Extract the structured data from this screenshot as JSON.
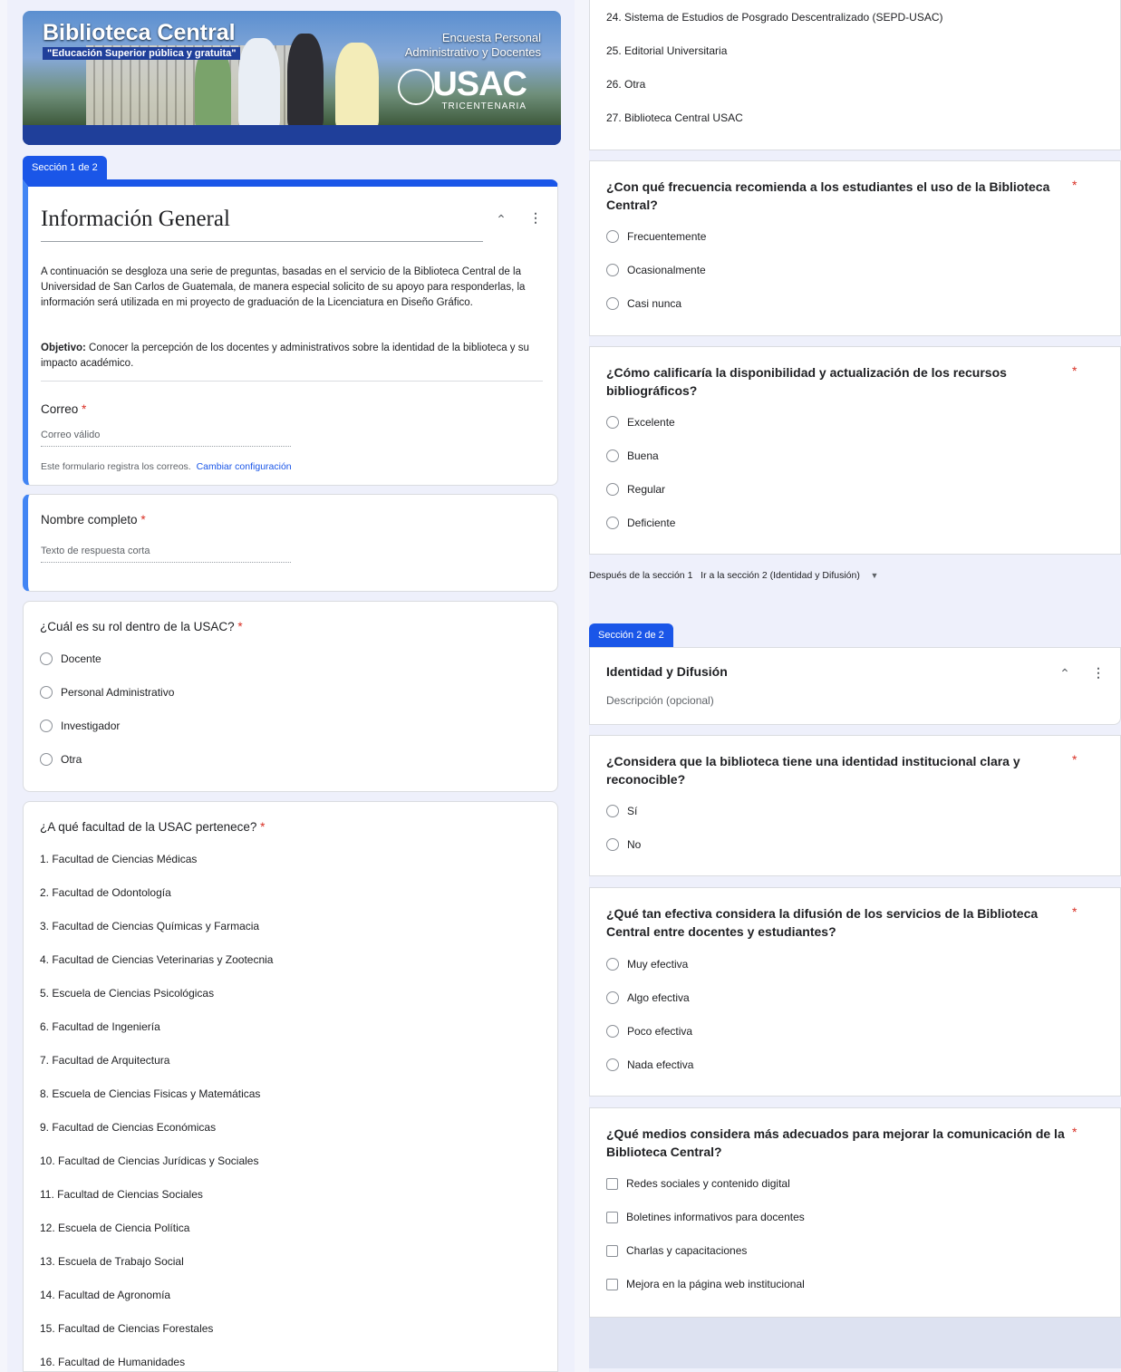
{
  "banner": {
    "title": "Biblioteca Central",
    "tagline": "\"Educación Superior pública y gratuita\"",
    "survey_line1": "Encuesta Personal",
    "survey_line2": "Administrativo y Docentes",
    "logo": "USAC",
    "logo_sub": "TRICENTENARIA"
  },
  "section1": {
    "tab": "Sección 1 de 2",
    "title": "Información General",
    "description": "A continuación se desgloza una serie de preguntas, basadas en el servicio de la Biblioteca Central de la Universidad de San Carlos de Guatemala, de manera especial solicito de su apoyo para responderlas, la información será utilizada en mi proyecto de graduación de la Licenciatura en Diseño Gráfico.",
    "objective_label": "Objetivo:",
    "objective_text": " Conocer la percepción de los docentes y administrativos sobre la identidad de la biblioteca y su impacto académico.",
    "email_label": "Correo",
    "email_placeholder": "Correo válido",
    "email_note": "Este formulario registra los correos.",
    "email_link": "Cambiar configuración"
  },
  "q_name": {
    "title": "Nombre completo",
    "placeholder": "Texto de respuesta corta"
  },
  "q_role": {
    "title": "¿Cuál es su rol dentro de la USAC?",
    "options": [
      "Docente",
      "Personal Administrativo",
      "Investigador",
      "Otra"
    ]
  },
  "q_faculty": {
    "title": "¿A qué facultad de la USAC pertenece?",
    "items": [
      "1.  Facultad de Ciencias Médicas",
      "2.  Facultad de Odontología",
      "3.  Facultad de Ciencias Químicas y Farmacia",
      "4.  Facultad de Ciencias Veterinarias y Zootecnia",
      "5.  Escuela de Ciencias Psicológicas",
      "6.  Facultad de Ingeniería",
      "7.  Facultad de Arquitectura",
      "8.  Escuela de Ciencias Fisicas y Matemáticas",
      "9.  Facultad de Ciencias Económicas",
      "10.  Facultad de Ciencias Jurídicas y Sociales",
      "11.  Facultad de Ciencias Sociales",
      "12.  Escuela de Ciencia Política",
      "13.  Escuela de Trabajo Social",
      "14.  Facultad de Agronomía",
      "15.  Facultad de Ciencias Forestales",
      "16.  Facultad de Humanidades"
    ],
    "items_continued": [
      "24.  Sistema de Estudios de Posgrado Descentralizado (SEPD-USAC)",
      "25.  Editorial Universitaria",
      "26.  Otra",
      "27.  Biblioteca Central USAC"
    ]
  },
  "q_recommend": {
    "title": "¿Con qué frecuencia recomienda a los estudiantes el uso de la Biblioteca Central?",
    "options": [
      "Frecuentemente",
      "Ocasionalmente",
      "Casi nunca"
    ]
  },
  "q_resources": {
    "title": "¿Cómo calificaría la disponibilidad y actualización de los recursos bibliográficos?",
    "options": [
      "Excelente",
      "Buena",
      "Regular",
      "Deficiente"
    ]
  },
  "after_section": {
    "label": "Después de la sección 1",
    "value": "Ir a la sección 2 (Identidad y Difusión)"
  },
  "section2": {
    "tab": "Sección 2 de 2",
    "title": "Identidad y Difusión",
    "description_placeholder": "Descripción (opcional)"
  },
  "q_identity": {
    "title": "¿Considera que la biblioteca tiene una identidad institucional clara y reconocible?",
    "options": [
      "Sí",
      "No"
    ]
  },
  "q_diffusion": {
    "title": "¿Qué tan efectiva considera la difusión de los servicios de la Biblioteca Central entre docentes y estudiantes?",
    "options": [
      "Muy efectiva",
      "Algo efectiva",
      "Poco efectiva",
      "Nada efectiva"
    ]
  },
  "q_media": {
    "title": "¿Qué medios considera más adecuados para mejorar la comunicación de la Biblioteca Central?",
    "options": [
      "Redes sociales y contenido digital",
      "Boletines informativos para docentes",
      "Charlas y capacitaciones",
      "Mejora en la página web institucional"
    ]
  },
  "required_mark": "*",
  "colors": {
    "accent": "#1a56e8",
    "required": "#d93025",
    "active_border": "#4285f4"
  },
  "icons": {
    "collapse": "collapse-icon",
    "more": "more-vert-icon",
    "dropdown": "dropdown-arrow-icon"
  }
}
